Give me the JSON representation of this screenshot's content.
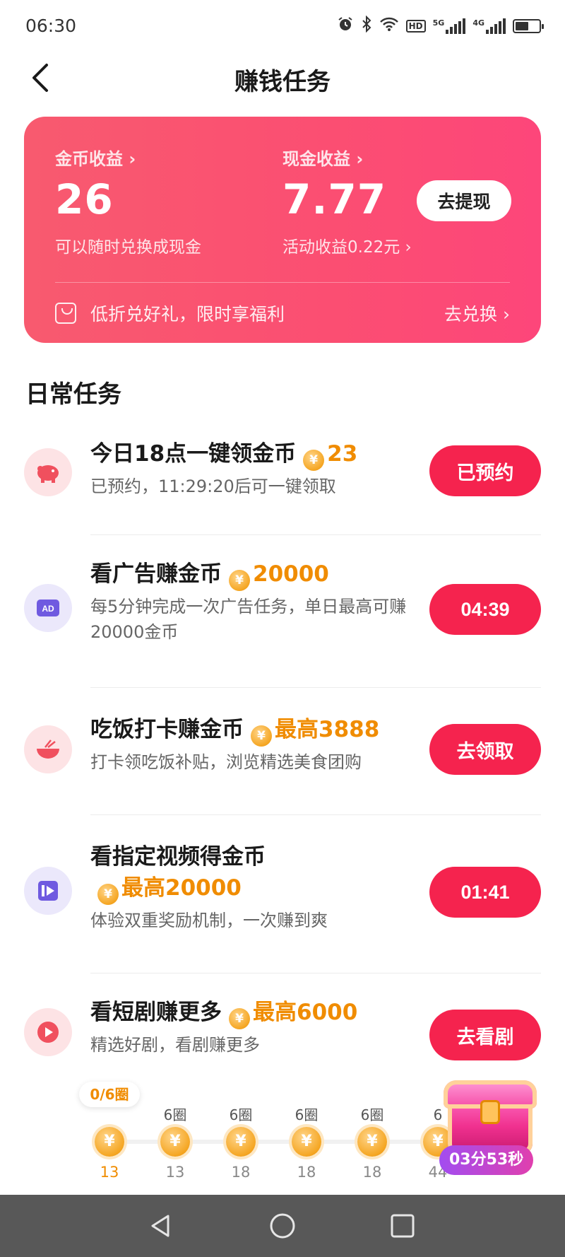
{
  "status": {
    "time": "06:30",
    "hd": "HD",
    "net1": "5G",
    "net2": "4G"
  },
  "header": {
    "title": "赚钱任务"
  },
  "earnings": {
    "coin_label": "金币收益 ›",
    "coin_value": "26",
    "coin_sub": "可以随时兑换成现金",
    "cash_label": "现金收益 ›",
    "cash_value": "7.77",
    "cash_sub": "活动收益0.22元 ›",
    "withdraw_button": "去提现",
    "promo_text": "低折兑好礼，限时享福利",
    "promo_link": "去兑换 ›"
  },
  "section_title": "日常任务",
  "tasks": [
    {
      "title": "今日18点一键领金币",
      "reward": "23",
      "desc": "已预约，11:29:20后可一键领取",
      "button": "已预约",
      "icon": "piggy-bank-icon"
    },
    {
      "title": "看广告赚金币",
      "reward": "20000",
      "desc": "每5分钟完成一次广告任务，单日最高可赚20000金币",
      "button": "04:39",
      "icon": "ad-icon"
    },
    {
      "title": "吃饭打卡赚金币",
      "reward": "最高3888",
      "desc": "打卡领吃饭补贴，浏览精选美食团购",
      "button": "去领取",
      "icon": "bowl-icon"
    },
    {
      "title": "看指定视频得金币",
      "reward": "最高20000",
      "desc": "体验双重奖励机制，一次赚到爽",
      "button": "01:41",
      "icon": "video-icon"
    },
    {
      "title": "看短剧赚更多",
      "reward": "最高6000",
      "desc": "精选好剧，看剧赚更多",
      "button": "去看剧",
      "icon": "drama-play-icon"
    }
  ],
  "coin_symbol": "¥",
  "progress": [
    {
      "top": "0/6圈",
      "value": "13"
    },
    {
      "top": "6圈",
      "value": "13"
    },
    {
      "top": "6圈",
      "value": "18"
    },
    {
      "top": "6圈",
      "value": "18"
    },
    {
      "top": "6圈",
      "value": "18"
    },
    {
      "top": "6",
      "value": "44"
    }
  ],
  "chest_timer": "03分53秒",
  "colors": {
    "primary_red": "#f5234e",
    "card_gradient_start": "#f85a6f",
    "card_gradient_end": "#fd467a",
    "reward_orange": "#f08c00",
    "nav_bar": "#585858"
  }
}
